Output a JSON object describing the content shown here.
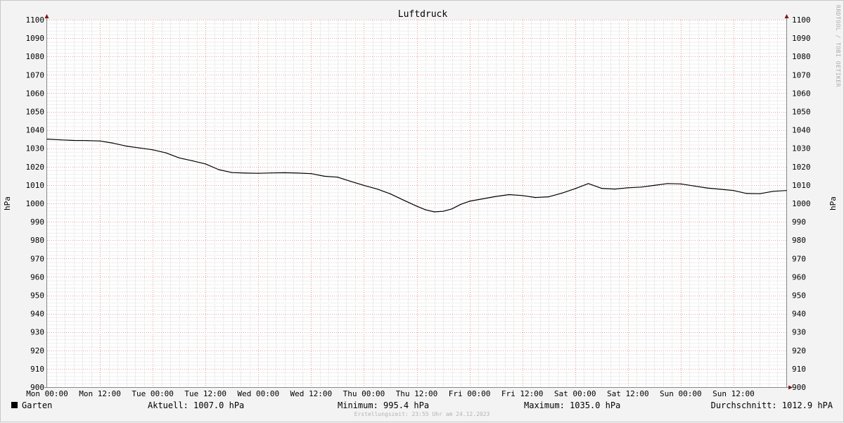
{
  "chart_data": {
    "type": "line",
    "title": "Luftdruck",
    "ylabel": "hPa",
    "ylim": [
      900,
      1100
    ],
    "y_major_step": 10,
    "y_ticks": [
      900,
      910,
      920,
      930,
      940,
      950,
      960,
      970,
      980,
      990,
      1000,
      1010,
      1020,
      1030,
      1040,
      1050,
      1060,
      1070,
      1080,
      1090,
      1100
    ],
    "x_unit": "hours",
    "x_range": [
      0,
      168
    ],
    "x_tick_labels": [
      "Mon 00:00",
      "Mon 12:00",
      "Tue 00:00",
      "Tue 12:00",
      "Wed 00:00",
      "Wed 12:00",
      "Thu 00:00",
      "Thu 12:00",
      "Fri 00:00",
      "Fri 12:00",
      "Sat 00:00",
      "Sat 12:00",
      "Sun 00:00",
      "Sun 12:00"
    ],
    "grid": true,
    "series": [
      {
        "name": "Garten",
        "color": "#000000",
        "x": [
          0,
          3,
          6,
          9,
          12,
          15,
          18,
          21,
          24,
          27,
          30,
          33,
          36,
          39,
          42,
          45,
          48,
          51,
          54,
          57,
          60,
          63,
          66,
          69,
          72,
          75,
          78,
          81,
          84,
          86,
          88,
          90,
          92,
          94,
          96,
          99,
          102,
          105,
          108,
          111,
          114,
          117,
          120,
          123,
          126,
          129,
          132,
          135,
          138,
          141,
          144,
          147,
          150,
          153,
          156,
          159,
          162,
          165,
          168
        ],
        "y": [
          1035,
          1034.6,
          1034.3,
          1034.2,
          1034,
          1032.8,
          1031.2,
          1030.2,
          1029.2,
          1027.5,
          1024.8,
          1023.2,
          1021.5,
          1018.4,
          1016.8,
          1016.5,
          1016.4,
          1016.6,
          1016.7,
          1016.5,
          1016.2,
          1014.8,
          1014.3,
          1012,
          1009.8,
          1007.8,
          1005.2,
          1001.8,
          998.5,
          996.5,
          995.4,
          995.7,
          997,
          999.5,
          1001.2,
          1002.5,
          1003.8,
          1004.8,
          1004.3,
          1003.2,
          1003.6,
          1005.6,
          1008,
          1010.8,
          1008.2,
          1007.8,
          1008.5,
          1008.9,
          1009.8,
          1010.8,
          1010.6,
          1009.5,
          1008.4,
          1007.7,
          1007,
          1005.4,
          1005.3,
          1006.6,
          1007
        ]
      }
    ],
    "stats": {
      "current_label": "Aktuell: 1007.0 hPa",
      "minimum_label": "Minimum: 995.4 hPa",
      "maximum_label": "Maximum: 1035.0 hPa",
      "average_label": "Durchschnitt: 1012.9 hPA"
    },
    "side_text": "RRDTOOL / TOBI OETIKER",
    "footer": "Erstellungszeit: 23:55 Uhr am 24.12.2023",
    "colors": {
      "background": "#f3f3f3",
      "canvas": "#ffffff",
      "minor_grid": "#dedede",
      "major_grid": "#e8a0a0",
      "axis": "#888888",
      "arrow": "#7a1a1a"
    }
  }
}
